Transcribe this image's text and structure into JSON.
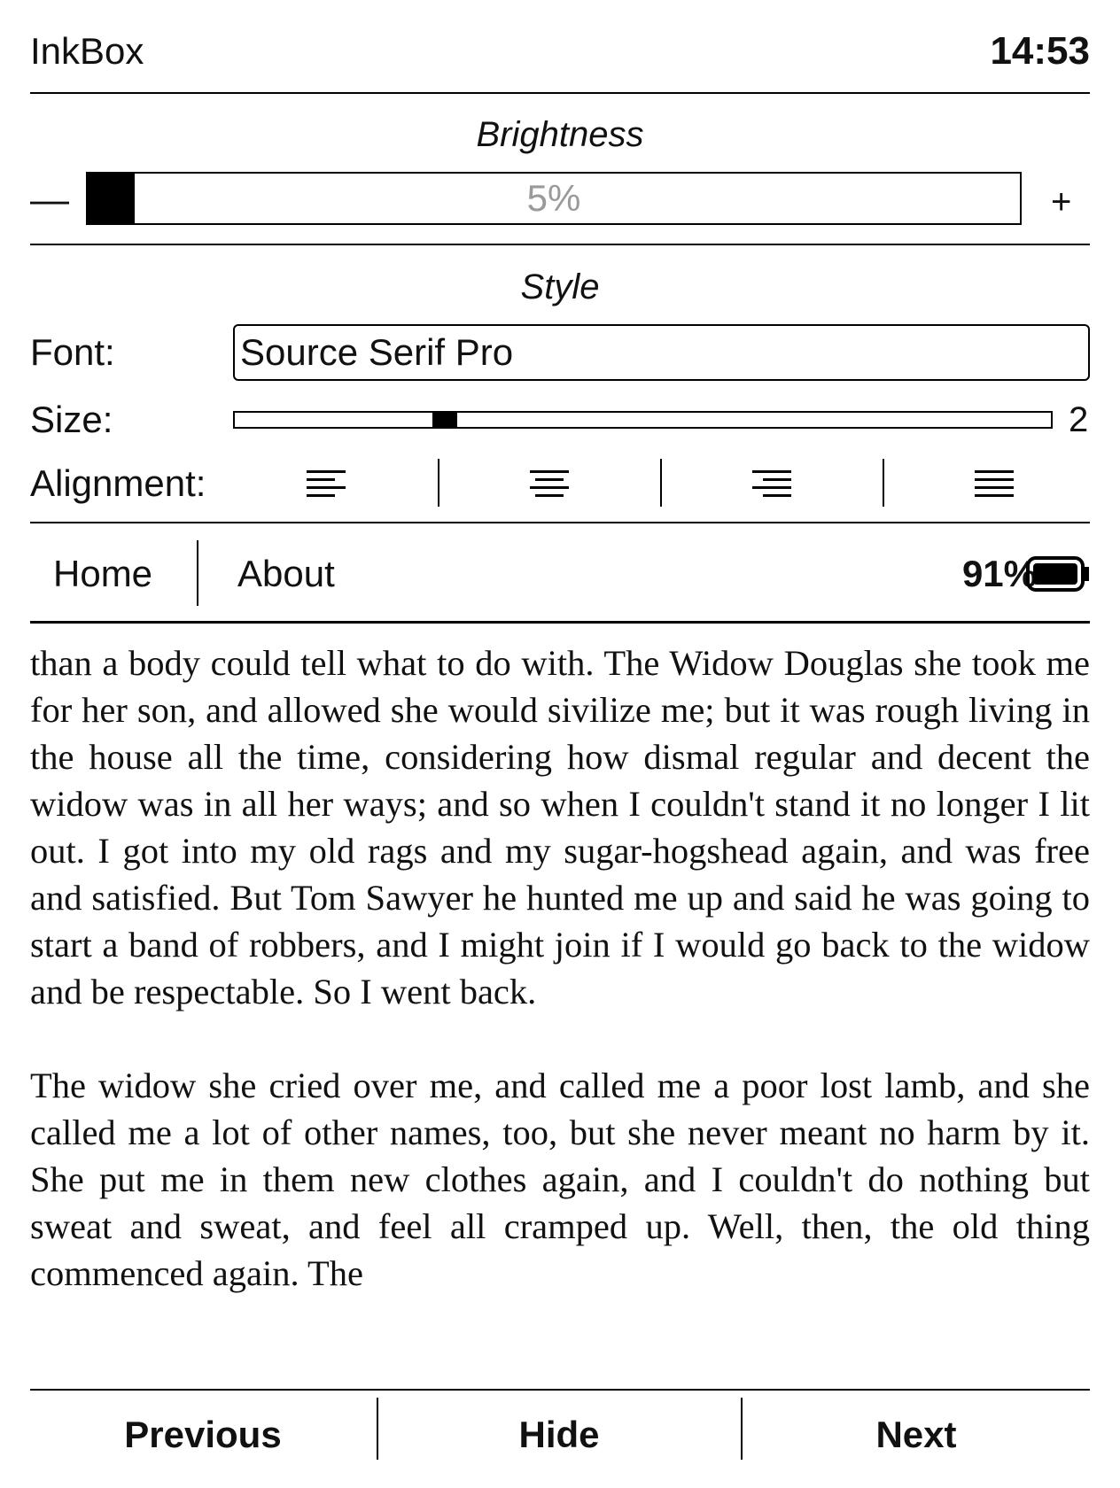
{
  "status_bar": {
    "app_name": "InkBox",
    "time": "14:53"
  },
  "brightness": {
    "title": "Brightness",
    "minus_label": "—",
    "plus_label": "+",
    "value_label": "5%",
    "value": 0.05
  },
  "style": {
    "title": "Style",
    "font_label": "Font:",
    "font_value": "Source Serif Pro",
    "size_label": "Size:",
    "size_value": "2",
    "size_level": 0.25,
    "alignment_label": "Alignment:",
    "alignment_options": [
      "align-left-icon",
      "align-center-icon",
      "align-right-icon",
      "align-justify-icon"
    ]
  },
  "nav": {
    "home": "Home",
    "about": "About",
    "battery": "91%",
    "battery_level": 0.91
  },
  "reading": {
    "paragraphs": [
      "than a body could tell what to do with. The Widow Douglas she took me for her son, and allowed she would sivilize me; but it was rough living in the house all the time, considering how dismal regular and decent the widow was in all her ways; and so when I couldn't stand it no longer I lit out. I got into my old rags and my sugar-hogshead again, and was free and satisfied. But Tom Sawyer he hunted me up and said he was going to start a band of robbers, and I might join if I would go back to the widow and be respectable. So I went back.",
      "The widow she cried over me, and called me a poor lost lamb, and she called me a lot of other names, too, but she never meant no harm by it. She put me in them new clothes again, and I couldn't do nothing but sweat and sweat, and feel all cramped up. Well, then, the old thing commenced again. The"
    ]
  },
  "bottom_bar": {
    "previous": "Previous",
    "hide": "Hide",
    "next": "Next"
  }
}
